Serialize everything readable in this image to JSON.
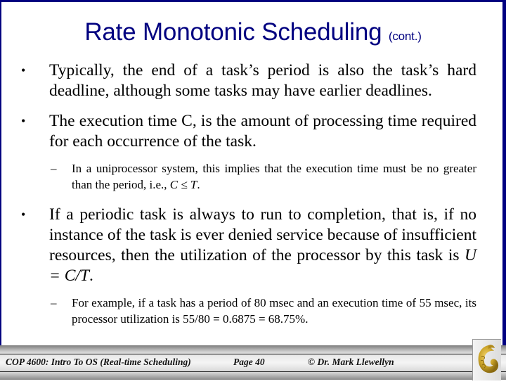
{
  "slide": {
    "title": "Rate Monotonic Scheduling",
    "title_suffix": "(cont.)",
    "bullets": [
      {
        "text": "Typically, the end of a task’s period is also the task’s hard deadline, although some tasks may have earlier deadlines.",
        "sub": []
      },
      {
        "text": "The execution time C, is the amount of processing time required for each occurrence of the task.",
        "sub": [
          {
            "text_before": "In a uniprocessor system, this implies that the execution time must be no greater than the period, i.e., ",
            "math": "C ≤ T",
            "text_after": "."
          }
        ]
      },
      {
        "text_before": "If a periodic task is always to run to completion, that is, if no instance of the task is ever denied service because of insufficient resources, then the utilization of the processor by this task is ",
        "math": "U = C/T",
        "text_after": ".",
        "sub": [
          {
            "text": "For example, if a task has a period of 80 msec and an execution time of 55 msec, its processor utilization is 55/80 = 0.6875 = 68.75%."
          }
        ]
      }
    ],
    "bullet_glyph": "•",
    "dash_glyph": "–"
  },
  "footer": {
    "course": "COP 4600: Intro To OS  (Real-time Scheduling)",
    "page": "Page 40",
    "copyright": "© Dr. Mark Llewellyn",
    "logo": "ucf-pegasus-logo-icon"
  },
  "colors": {
    "frame": "#000080",
    "title": "#000080",
    "logo_gold": "#c9a227"
  }
}
